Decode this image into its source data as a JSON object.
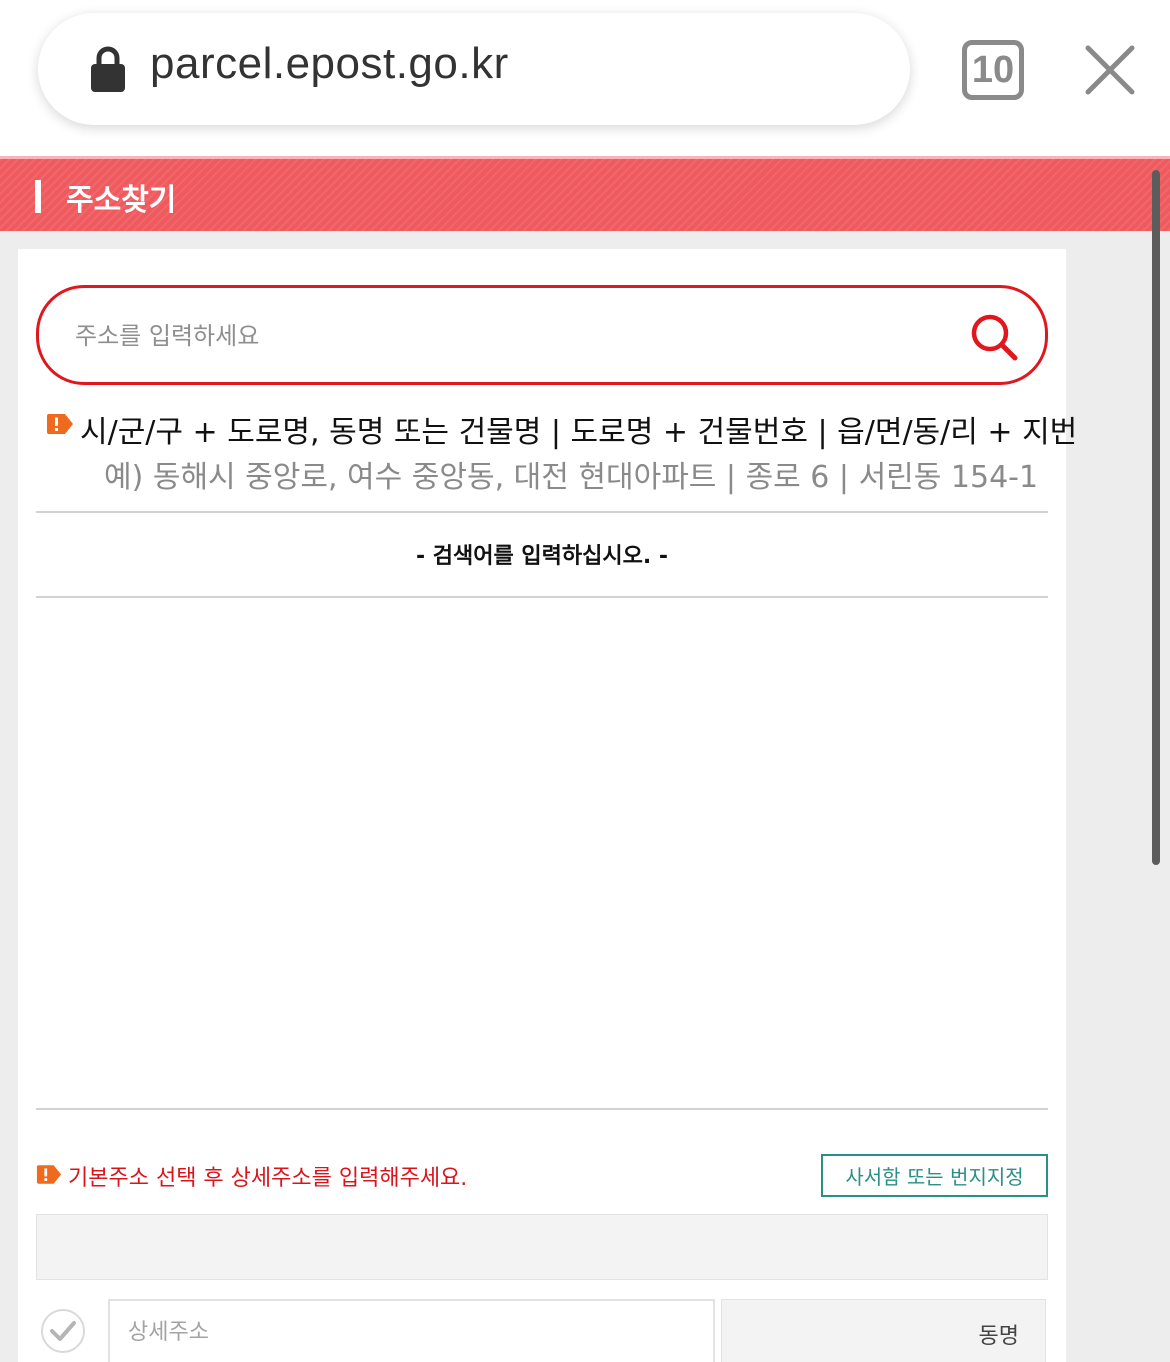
{
  "browser": {
    "url": "parcel.epost.go.kr",
    "tab_count": "10"
  },
  "header": {
    "title": "주소찾기"
  },
  "search": {
    "placeholder": "주소를 입력하세요",
    "value": ""
  },
  "guide": {
    "format": "시/군/구 + 도로명, 동명 또는 건물명 | 도로명 + 건물번호 | 읍/면/동/리 + 지번",
    "example": "예) 동해시 중앙로, 여수 중앙동, 대전 현대아파트 | 종로 6 | 서린동 154-1"
  },
  "results": {
    "empty_message": "- 검색어를 입력하십시오. -"
  },
  "detail": {
    "notice": "기본주소 선택 후 상세주소를 입력해주세요.",
    "pobox_button_label": "사서함 또는 번지지정",
    "base_address_value": "",
    "detail_placeholder": "상세주소",
    "dong_label": "동명"
  },
  "colors": {
    "brand_red": "#e0171d",
    "header_red": "#ef5a5f",
    "teal": "#2a8f86"
  },
  "icons": {
    "lock": "lock-icon",
    "tabs": "tabs-icon",
    "close": "close-icon",
    "search": "search-icon",
    "notice": "exclamation-tag-icon",
    "check": "checkmark-circle-icon"
  }
}
